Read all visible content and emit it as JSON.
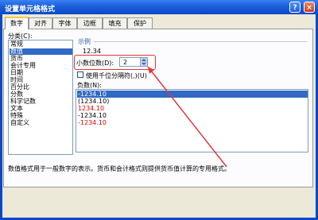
{
  "window": {
    "title": "设置单元格格式",
    "help_label": "?",
    "close_label": "×"
  },
  "tabs": [
    "数字",
    "对齐",
    "字体",
    "边框",
    "填充",
    "保护"
  ],
  "category": {
    "label": "分类(C):",
    "items": [
      "常规",
      "数值",
      "货币",
      "会计专用",
      "日期",
      "时间",
      "百分比",
      "分数",
      "科学记数",
      "文本",
      "特殊",
      "自定义"
    ],
    "selected_index": 1
  },
  "sample": {
    "label": "示例",
    "value": "12.34"
  },
  "decimal_places": {
    "label": "小数位数(D):",
    "value": "2"
  },
  "thousands_separator": {
    "label": "使用千位分隔符(,)(U)",
    "checked": false
  },
  "negative_numbers": {
    "label": "负数(N):",
    "items": [
      {
        "text": "-1234.10",
        "red": false
      },
      {
        "text": "(1234.10)",
        "red": false
      },
      {
        "text": "1234.10",
        "red": true
      },
      {
        "text": "-1234.10",
        "red": false
      },
      {
        "text": "-1234.10",
        "red": true
      }
    ],
    "selected_index": 0
  },
  "description": "数值格式用于一般数字的表示。货币和会计格式则提供货币值计算的专用格式。",
  "colors": {
    "title_bar": "#0a48c8",
    "selection": "#316ac5",
    "annotation_red": "#e2383a",
    "negative_red": "#e00000"
  }
}
